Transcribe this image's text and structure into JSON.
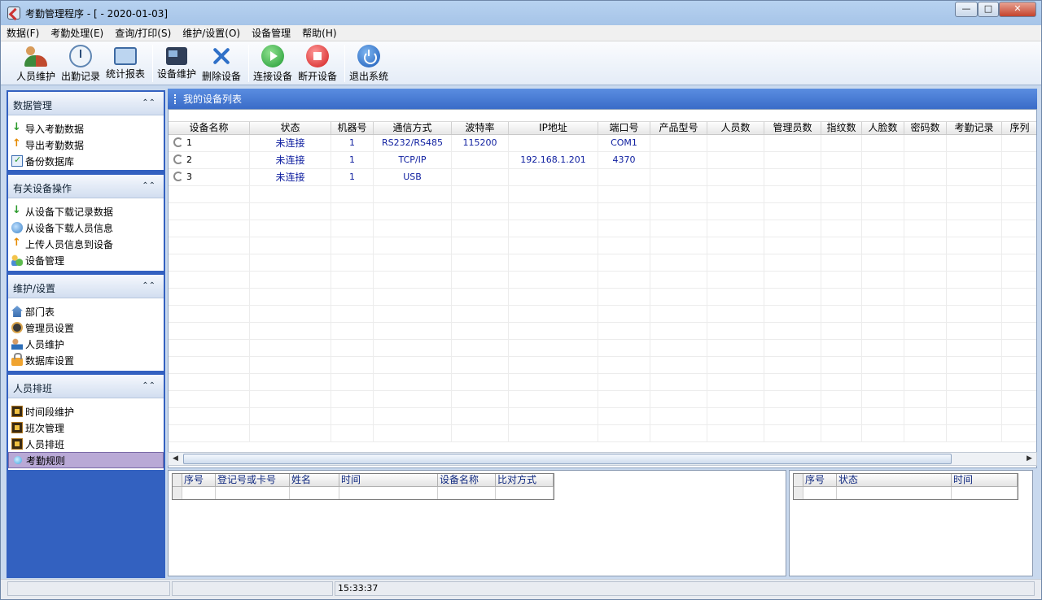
{
  "window": {
    "title": "考勤管理程序 - [ - 2020-01-03]",
    "controls": {
      "minimize": "—",
      "maximize": "□",
      "close": "✕"
    }
  },
  "menu": [
    "数据(F)",
    "考勤处理(E)",
    "查询/打印(S)",
    "维护/设置(O)",
    "设备管理",
    "帮助(H)"
  ],
  "toolbar": {
    "personnel": "人员维护",
    "records": "出勤记录",
    "reports": "统计报表",
    "device_maint": "设备维护",
    "delete_device": "删除设备",
    "connect": "连接设备",
    "disconnect": "断开设备",
    "exit": "退出系统"
  },
  "sidebar": {
    "groups": [
      {
        "title": "数据管理",
        "items": [
          "导入考勤数据",
          "导出考勤数据",
          "备份数据库"
        ]
      },
      {
        "title": "有关设备操作",
        "items": [
          "从设备下载记录数据",
          "从设备下载人员信息",
          "上传人员信息到设备",
          "设备管理"
        ]
      },
      {
        "title": "维护/设置",
        "items": [
          "部门表",
          "管理员设置",
          "人员维护",
          "数据库设置"
        ]
      },
      {
        "title": "人员排班",
        "items": [
          "时间段维护",
          "班次管理",
          "人员排班",
          "考勤规则"
        ]
      }
    ]
  },
  "main": {
    "title": "我的设备列表",
    "columns": [
      "设备名称",
      "状态",
      "机器号",
      "通信方式",
      "波特率",
      "IP地址",
      "端口号",
      "产品型号",
      "人员数",
      "管理员数",
      "指纹数",
      "人脸数",
      "密码数",
      "考勤记录",
      "序列"
    ],
    "rows": [
      [
        "1",
        "未连接",
        "1",
        "RS232/RS485",
        "115200",
        "",
        "COM1",
        "",
        "",
        "",
        "",
        "",
        "",
        "",
        ""
      ],
      [
        "2",
        "未连接",
        "1",
        "TCP/IP",
        "",
        "192.168.1.201",
        "4370",
        "",
        "",
        "",
        "",
        "",
        "",
        "",
        ""
      ],
      [
        "3",
        "未连接",
        "1",
        "USB",
        "",
        "",
        "",
        "",
        "",
        "",
        "",
        "",
        "",
        "",
        ""
      ]
    ]
  },
  "bottom_left": {
    "columns": [
      "序号",
      "登记号或卡号",
      "姓名",
      "时间",
      "设备名称",
      "比对方式"
    ]
  },
  "bottom_right": {
    "columns": [
      "序号",
      "状态",
      "时间"
    ]
  },
  "status": {
    "time": "15:33:37"
  }
}
